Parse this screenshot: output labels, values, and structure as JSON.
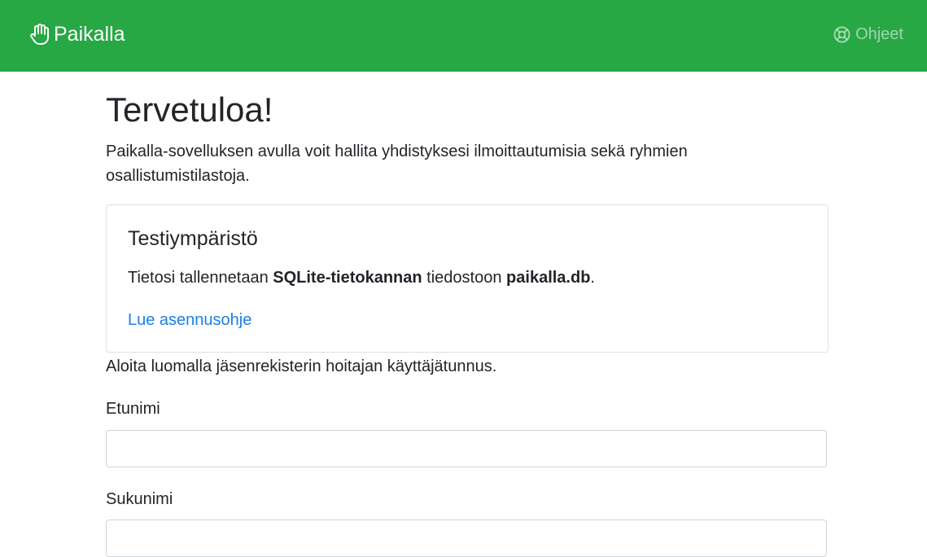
{
  "navbar": {
    "brand": {
      "icon": "hand-icon",
      "label": "Paikalla"
    },
    "help": {
      "icon": "lifering-icon",
      "label": "Ohjeet"
    },
    "background_color": "#28a745"
  },
  "main": {
    "heading": "Tervetuloa!",
    "lead": "Paikalla-sovelluksen avulla voit hallita yhdistyksesi ilmoittautumisia sekä ryhmien osallistumistilastoja.",
    "card": {
      "title": "Testiympäristö",
      "text_prefix": "Tietosi tallennetaan ",
      "text_bold1": "SQLite-tietokannan",
      "text_middle": " tiedostoon ",
      "text_bold2": "paikalla.db",
      "text_suffix": ".",
      "link": "Lue asennusohje",
      "link_color": "#1a7fe8"
    },
    "intro": "Aloita luomalla jäsenrekisterin hoitajan käyttäjätunnus.",
    "form": {
      "first_name_label": "Etunimi",
      "first_name_value": "",
      "last_name_label": "Sukunimi",
      "last_name_value": ""
    }
  }
}
